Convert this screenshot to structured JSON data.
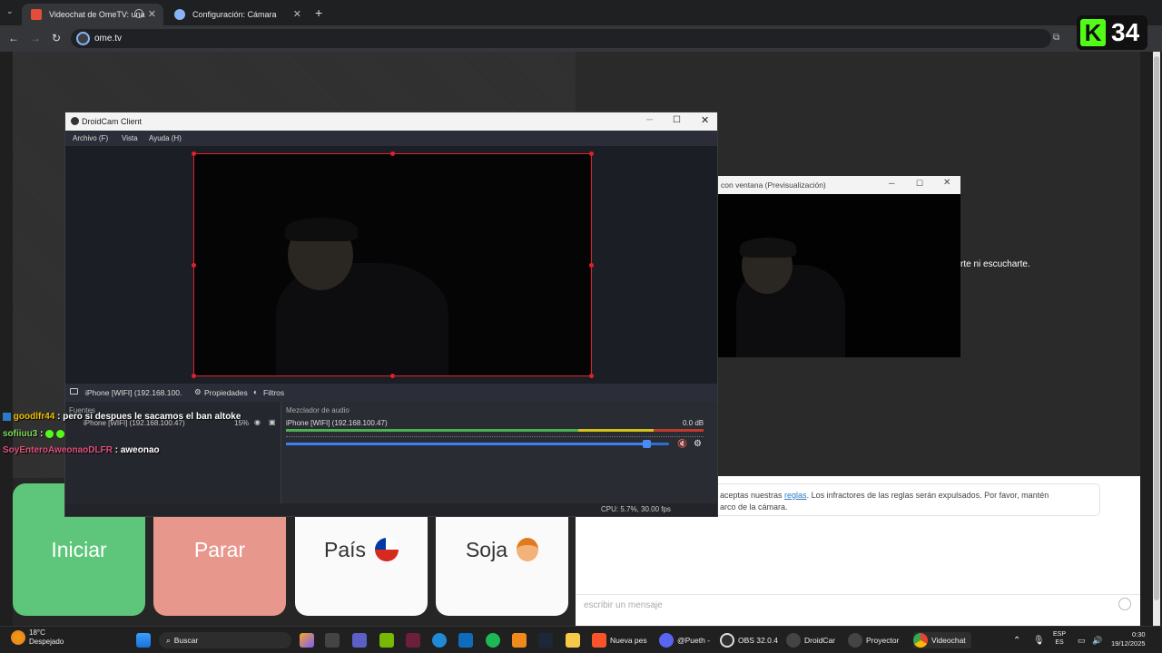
{
  "browser": {
    "tabs": [
      {
        "title": "Videochat de OmeTV: una",
        "active": true
      },
      {
        "title": "Configuración: Cámara",
        "active": false
      }
    ],
    "new_tab_symbol": "+",
    "url": "ome.tv"
  },
  "overlay_badge": {
    "letter": "K",
    "number": "34"
  },
  "droidcam": {
    "title": "DroidCam Client",
    "menu": [
      "Archivo (F)",
      "Vista",
      "Ayuda (H)"
    ],
    "source_label": "iPhone [WIFI] (192.168.100.",
    "properties_label": "Propiedades",
    "filters_label": "Filtros",
    "sources_panel_title": "Fuentes",
    "source_item": "iPhone [WIFI] (192.168.100.47)",
    "source_item_pct": "15%",
    "mixer_title": "Mezclador de audio",
    "mixer_source": "iPhone [WIFI] (192.168.100.47)",
    "mixer_db": "0.0 dB",
    "volume_level": 0.94,
    "status": "CPU: 5.7%, 30.00 fps"
  },
  "projector": {
    "title": "con ventana (Previsualización)"
  },
  "peer_text": "rte ni escucharte.",
  "chat_overlay": [
    {
      "user": "goodlfr44",
      "text": ": pero si despues le sacamos el ban altoke",
      "color": "#f0c000"
    },
    {
      "user": "sofiiuu3",
      "text": ":",
      "color": "#7ed957"
    },
    {
      "user": "SoyEnteroAweonaoDLFR",
      "text": ": aweonao",
      "color": "#e0507a"
    }
  ],
  "rules_notice": {
    "prefix": "aceptas nuestras ",
    "link": "reglas",
    "suffix": ". Los infractores de las reglas serán expulsados. Por favor, mantén",
    "line2": "arco de la cámara."
  },
  "message_placeholder": "escribir un mensaje",
  "buttons": {
    "start": "Iniciar",
    "stop": "Parar",
    "country": "País",
    "gender": "Soja"
  },
  "taskbar": {
    "weather_temp": "18°C",
    "weather_desc": "Despejado",
    "search": "Buscar",
    "apps": [
      {
        "label": "Nueva pes",
        "icon": "brave-icon"
      },
      {
        "label": "@Pueth -",
        "icon": "discord-icon"
      },
      {
        "label": "OBS 32.0.4",
        "icon": "obs-icon"
      },
      {
        "label": "DroidCar",
        "icon": "droidcam-icon"
      },
      {
        "label": "Proyector",
        "icon": "projector-icon"
      },
      {
        "label": "Videochat",
        "icon": "chrome-icon"
      }
    ],
    "lang1": "ESP",
    "lang2": "ES",
    "time": "0:30",
    "date": "19/12/2025"
  },
  "colors": {
    "start": "#5dc67a",
    "stop": "#e8978c",
    "selection": "#e0212b",
    "link": "#2a7bc6"
  }
}
